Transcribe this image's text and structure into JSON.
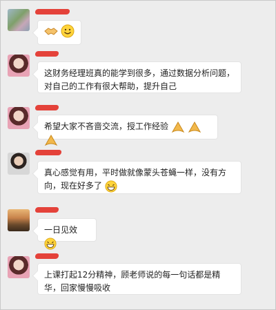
{
  "chat": {
    "messages": [
      {
        "avatar": "landscape-avatar",
        "text": "",
        "emojis": [
          "handshake-emoji",
          "smile-emoji"
        ]
      },
      {
        "avatar": "woman-avatar",
        "text": "这财务经理班真的能学到很多，通过数据分析问题，对自己的工作有很大帮助，提升自己"
      },
      {
        "avatar": "woman-avatar",
        "text": "希望大家不吝啬交流，授工作经验",
        "emojis": [
          "clap-emoji",
          "clap-emoji",
          "clap-emoji"
        ]
      },
      {
        "avatar": "man-avatar",
        "text": "真心感觉有用，平时做就像蒙头苍蝇一样，没有方向，现在好多了",
        "emojis": [
          "grin-emoji"
        ]
      },
      {
        "avatar": "sunset-avatar",
        "text": "一日见效",
        "emojis": [
          "grin-emoji"
        ]
      },
      {
        "avatar": "woman-avatar",
        "text": "上课打起12分精神，顾老师说的每一句话都是精华，回家慢慢吸收"
      }
    ]
  },
  "colors": {
    "background": "#ededed",
    "bubble": "#ffffff",
    "name_redaction": "#e2231a"
  }
}
